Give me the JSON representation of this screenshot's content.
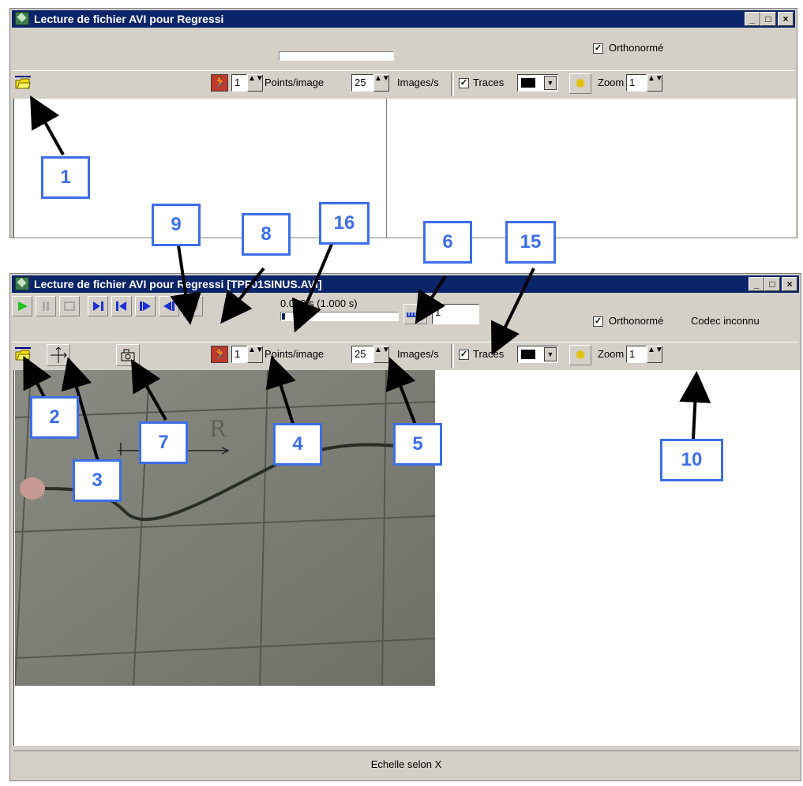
{
  "top_window": {
    "title": "Lecture de fichier AVI pour Regressi",
    "orthonorme_label": "Orthonormé",
    "orthonorme_checked": true,
    "points_value": "1",
    "points_label": "Points/image",
    "images_value": "25",
    "images_label": "Images/s",
    "traces_label": "Traces",
    "traces_checked": true,
    "zoom_label": "Zoom",
    "zoom_value": "1"
  },
  "bottom_window": {
    "title": "Lecture de fichier AVI pour Regressi [TPF01SINUS.AVI]",
    "time_text": "0.000 s (1.000 s)",
    "scale_value": "1",
    "orthonorme_label": "Orthonormé",
    "orthonorme_checked": true,
    "codec_label": "Codec inconnu",
    "points_value": "1",
    "points_label": "Points/image",
    "images_value": "25",
    "images_label": "Images/s",
    "traces_label": "Traces",
    "traces_checked": true,
    "zoom_label": "Zoom",
    "zoom_value": "1",
    "video_label": "R",
    "status_text": "Echelle selon X",
    "progress_fraction": 0.02
  },
  "window_buttons": {
    "minimize": "_",
    "maximize": "□",
    "close": "×"
  },
  "check_mark": "✓",
  "callouts": [
    "1",
    "2",
    "3",
    "4",
    "5",
    "6",
    "7",
    "8",
    "9",
    "10",
    "15",
    "16"
  ],
  "colors": {
    "titlebar": "#0a246a",
    "callout": "#3d6ee8",
    "window_bg": "#d4d0c8"
  }
}
